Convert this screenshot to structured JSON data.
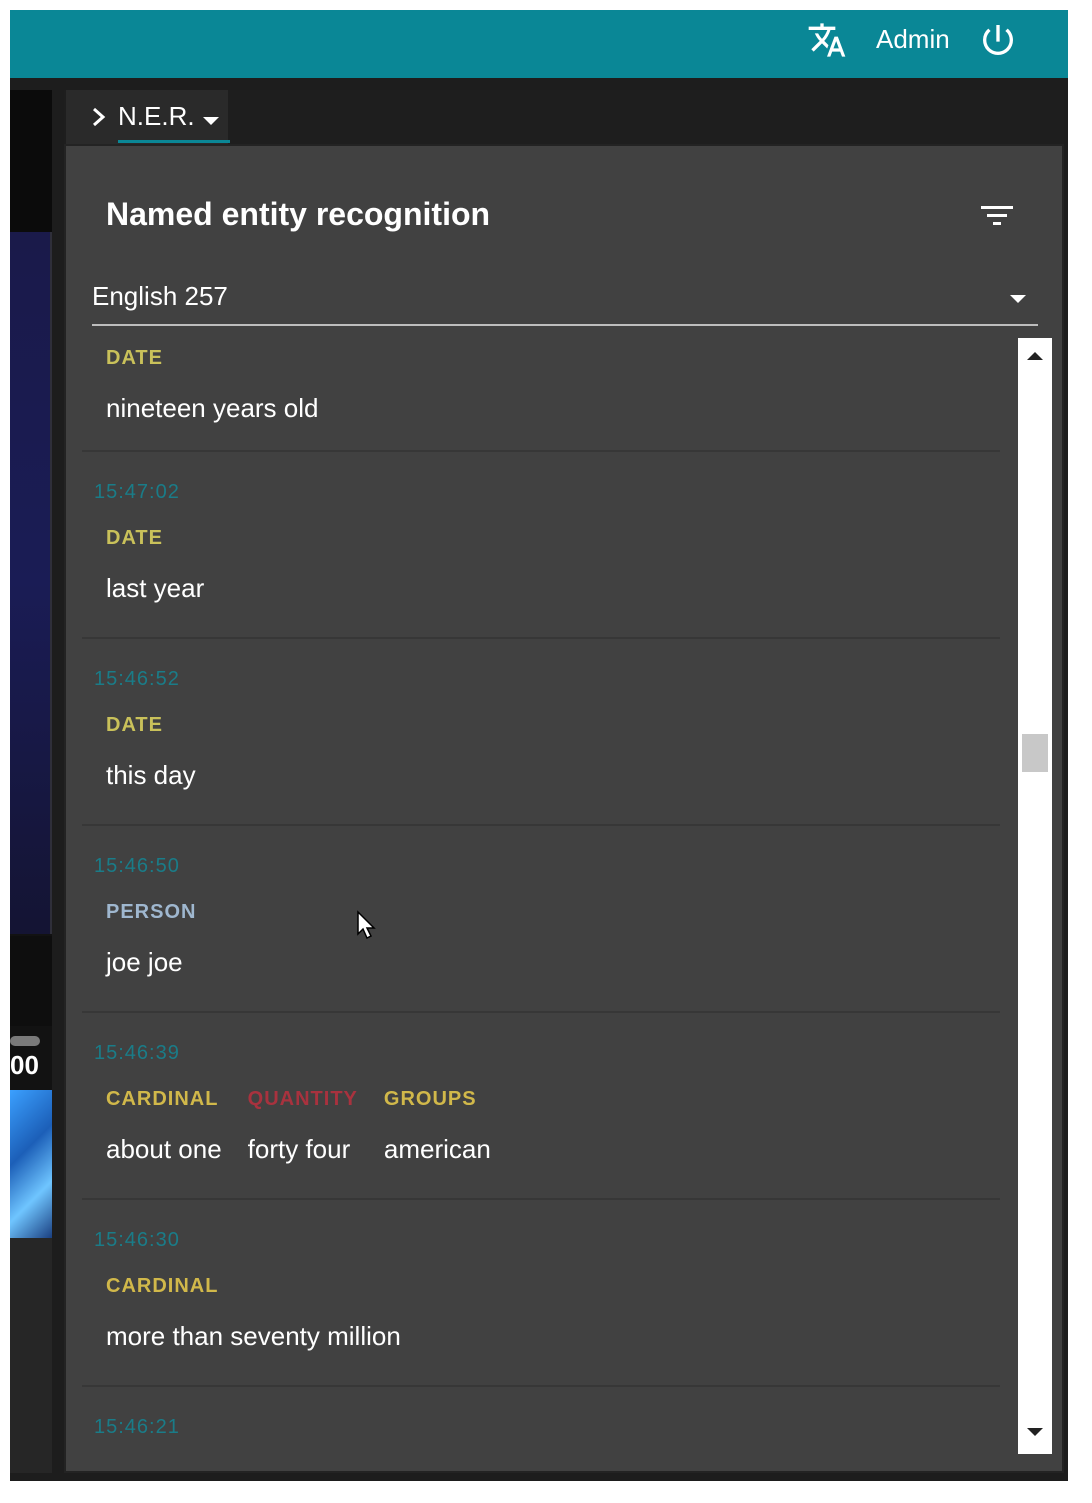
{
  "topbar": {
    "accent": "#0a8796",
    "translate_icon": "translate-icon",
    "user_label": "Admin",
    "power_icon": "power-icon"
  },
  "video_strip": {
    "time_text": "00"
  },
  "panel": {
    "tab": {
      "label": "N.E.R.",
      "chevron_icon": "chevron-right-icon",
      "caret_icon": "caret-down-icon"
    },
    "title": "Named entity recognition",
    "filter_icon": "filter-list-icon",
    "language_select": {
      "value": "English 257",
      "caret_icon": "caret-down-icon"
    }
  },
  "entity_colors": {
    "DATE": "#c9c15a",
    "PERSON": "#9fb7cf",
    "CARDINAL": "#d1b84a",
    "QUANTITY": "#a8323e",
    "GROUPS": "#d1b84a"
  },
  "entries": [
    {
      "time": "",
      "items": [
        {
          "type": "DATE",
          "text": "nineteen years old"
        }
      ]
    },
    {
      "time": "15:47:02",
      "items": [
        {
          "type": "DATE",
          "text": "last year"
        }
      ]
    },
    {
      "time": "15:46:52",
      "items": [
        {
          "type": "DATE",
          "text": "this day"
        }
      ]
    },
    {
      "time": "15:46:50",
      "items": [
        {
          "type": "PERSON",
          "text": "joe joe"
        }
      ]
    },
    {
      "time": "15:46:39",
      "items": [
        {
          "type": "CARDINAL",
          "text": "about one"
        },
        {
          "type": "QUANTITY",
          "text": "forty four"
        },
        {
          "type": "GROUPS",
          "text": "american"
        }
      ]
    },
    {
      "time": "15:46:30",
      "items": [
        {
          "type": "CARDINAL",
          "text": "more than seventy million"
        }
      ]
    },
    {
      "time": "15:46:21",
      "items": []
    }
  ],
  "scrollbar": {
    "up_icon": "arrow-up-icon",
    "down_icon": "arrow-down-icon",
    "position": 0.36
  }
}
